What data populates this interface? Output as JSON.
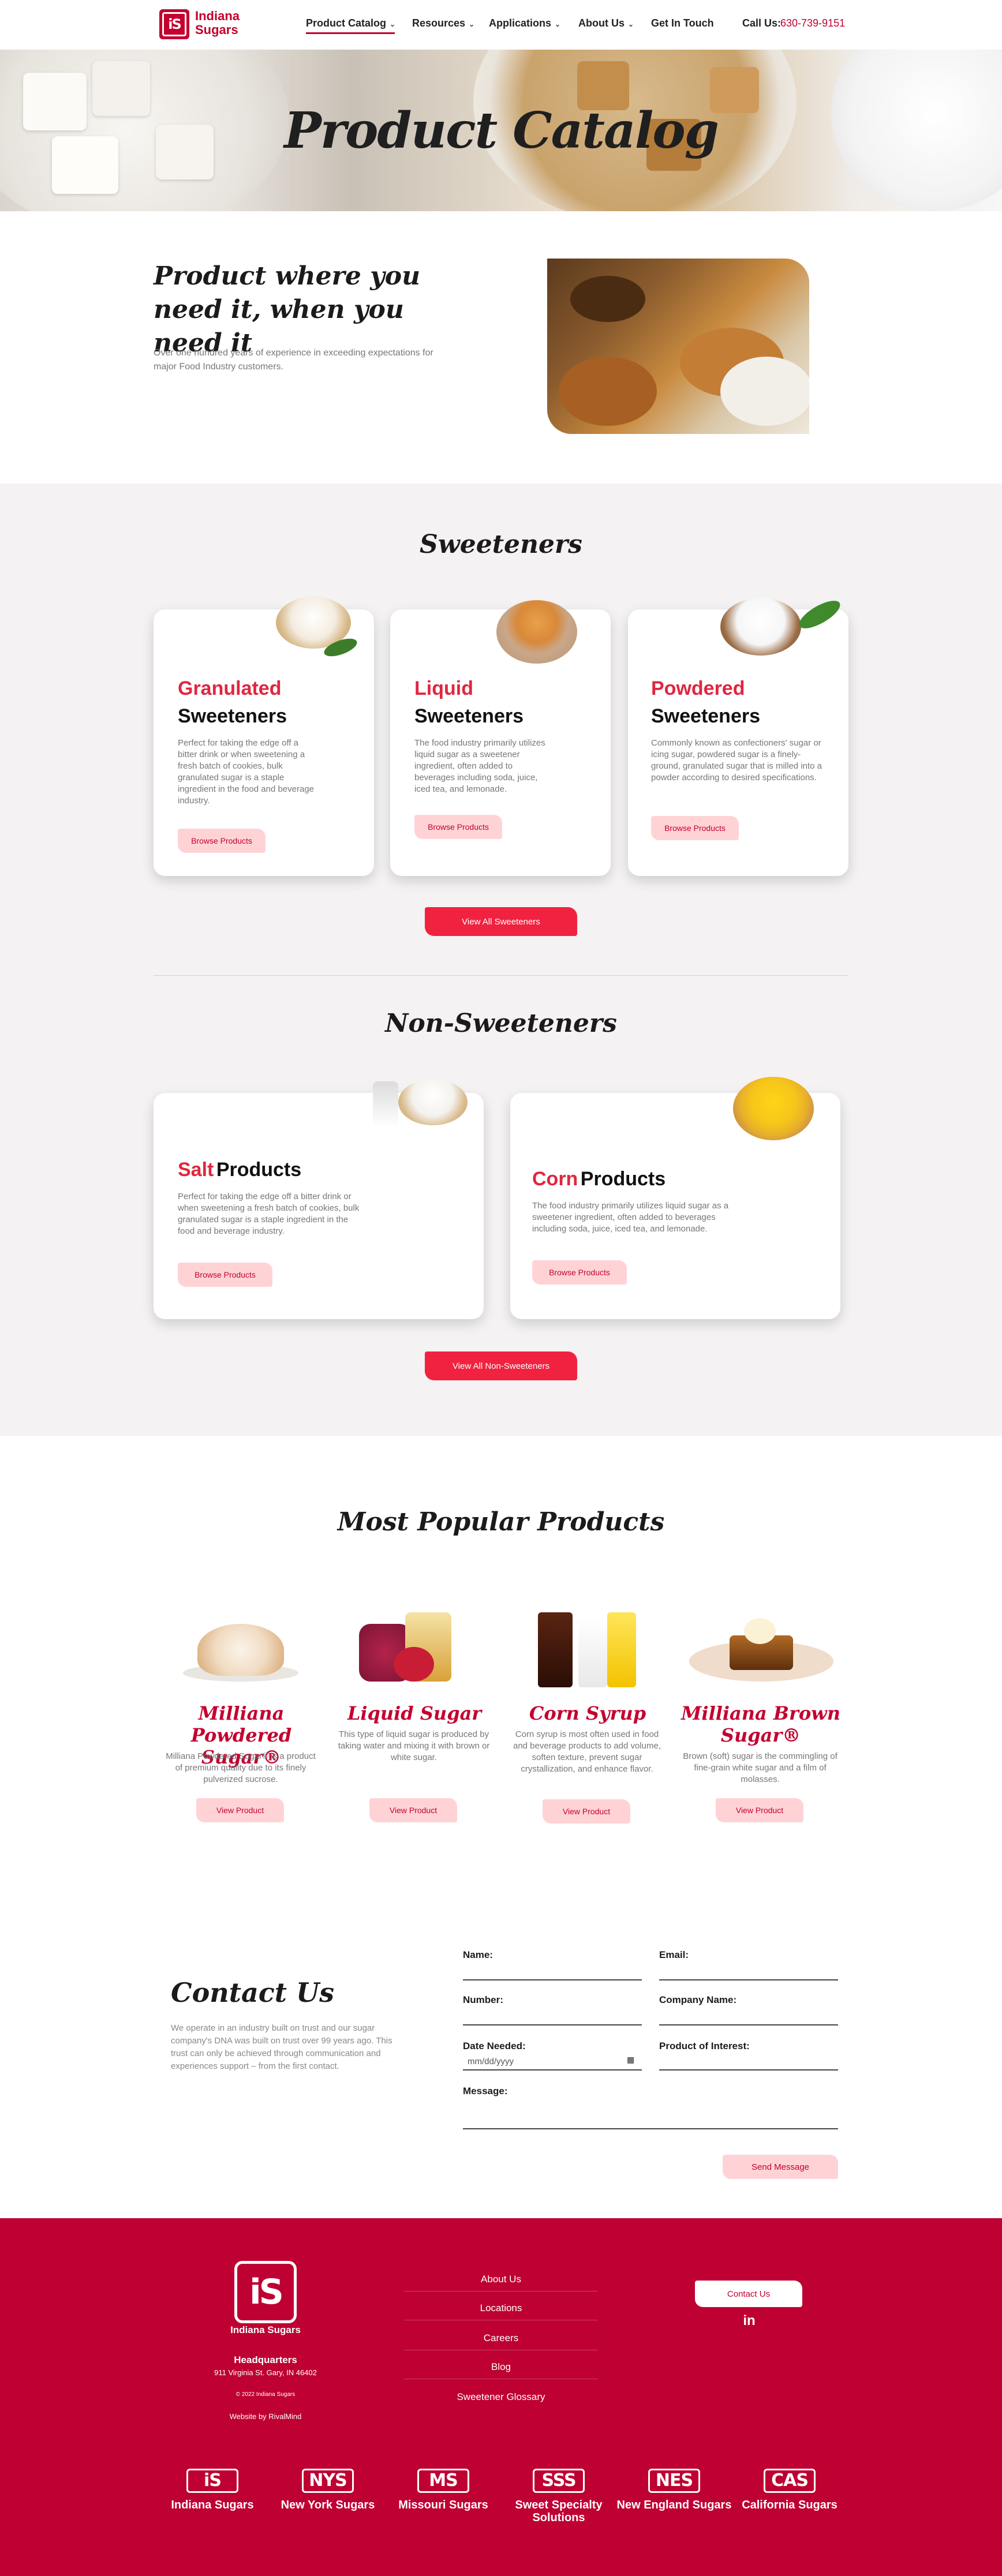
{
  "brand": {
    "name": "Indiana Sugars",
    "logo_text": "iS",
    "color": "#c3002f",
    "accent": "#f0223f"
  },
  "nav": {
    "items": [
      {
        "label": "Product Catalog",
        "dropdown": true,
        "active": true
      },
      {
        "label": "Resources",
        "dropdown": true
      },
      {
        "label": "Applications",
        "dropdown": true
      },
      {
        "label": "About Us",
        "dropdown": true
      },
      {
        "label": "Get In Touch",
        "dropdown": false
      }
    ],
    "call_label": "Call Us:",
    "phone": "630-739-9151"
  },
  "hero": {
    "title": "Product Catalog"
  },
  "intro": {
    "heading": "Product where you need it, when you need it",
    "body": "Over one hundred years of experience in exceeding expectations for major Food Industry customers."
  },
  "sweeteners": {
    "title": "Sweeteners",
    "cards": [
      {
        "accent": "Granulated",
        "title": "Sweeteners",
        "body": "Perfect for taking the edge off a bitter drink or when sweetening a fresh batch of cookies, bulk granulated sugar is a staple ingredient in the food and beverage industry.",
        "button": "Browse Products"
      },
      {
        "accent": "Liquid",
        "title": "Sweeteners",
        "body": "The food industry primarily utilizes liquid sugar as a sweetener ingredient, often added to beverages including soda, juice, iced tea, and lemonade.",
        "button": "Browse Products"
      },
      {
        "accent": "Powdered",
        "title": "Sweeteners",
        "body": "Commonly known as confectioners' sugar or icing sugar, powdered sugar is a finely-ground, granulated sugar that is milled into a powder according to desired specifications.",
        "button": "Browse Products"
      }
    ],
    "view_all": "View All Sweeteners"
  },
  "non_sweeteners": {
    "title": "Non-Sweeteners",
    "cards": [
      {
        "accent": "Salt",
        "title": "Products",
        "body": "Perfect for taking the edge off a bitter drink or when sweetening a fresh batch of cookies, bulk granulated sugar is a staple ingredient in the food and beverage industry.",
        "button": "Browse Products"
      },
      {
        "accent": "Corn",
        "title": "Products",
        "body": "The food industry primarily utilizes liquid sugar as a sweetener ingredient, often added to beverages including soda, juice, iced tea, and lemonade.",
        "button": "Browse Products"
      }
    ],
    "view_all": "View All Non-Sweeteners"
  },
  "popular": {
    "title": "Most Popular Products",
    "items": [
      {
        "title": "Milliana Powdered Sugar®",
        "body": "Milliana Powdered Sugar® is a product of premium quality due to its finely pulverized sucrose.",
        "button": "View Product"
      },
      {
        "title": "Liquid Sugar",
        "body": "This type of liquid sugar is produced by taking water and mixing it with brown or white sugar.",
        "button": "View Product"
      },
      {
        "title": "Corn Syrup",
        "body": "Corn syrup is most often used in food and beverage products to add volume, soften texture, prevent sugar crystallization, and enhance flavor.",
        "button": "View Product"
      },
      {
        "title": "Milliana Brown Sugar®",
        "body": "Brown (soft) sugar is the commingling of fine-grain white sugar and a film of molasses.",
        "button": "View Product"
      }
    ]
  },
  "contact": {
    "title": "Contact Us",
    "body": "We operate in an industry built on trust and our sugar company's DNA was built on trust over 99 years ago. This trust can only be achieved through communication and experiences support – from the first contact.",
    "fields": {
      "name": "Name:",
      "email": "Email:",
      "number": "Number:",
      "company": "Company Name:",
      "date": "Date Needed:",
      "date_placeholder": "mm/dd/yyyy",
      "product": "Product of Interest:",
      "message": "Message:"
    },
    "submit": "Send Message"
  },
  "footer": {
    "company": "Indiana Sugars",
    "hq_label": "Headquarters",
    "address": "911 Virginia St. Gary, IN 46402",
    "copyright": "© 2022 Indiana Sugars",
    "credit": "Website by RivalMind",
    "links": [
      "About Us",
      "Locations",
      "Careers",
      "Blog",
      "Sweetener Glossary"
    ],
    "contact_button": "Contact Us",
    "social": "in",
    "brands": [
      {
        "mark": "iS",
        "name": "Indiana Sugars"
      },
      {
        "mark": "NYS",
        "name": "New York Sugars"
      },
      {
        "mark": "MS",
        "name": "Missouri Sugars"
      },
      {
        "mark": "SSS",
        "name": "Sweet Specialty Solutions"
      },
      {
        "mark": "NES",
        "name": "New England Sugars"
      },
      {
        "mark": "CAS",
        "name": "California Sugars"
      }
    ]
  }
}
